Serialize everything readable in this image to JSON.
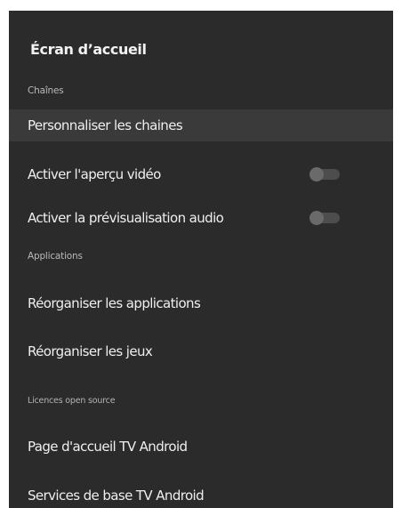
{
  "header": {
    "title": "Écran d’accueil"
  },
  "sections": {
    "channels": "Chaînes",
    "applications": "Applications",
    "licenses": "Licences open source"
  },
  "items": {
    "customize_channels": "Personnaliser les chaines",
    "video_preview": "Activer l'aperçu vidéo",
    "audio_preview": "Activer la prévisualisation audio",
    "reorder_apps": "Réorganiser les applications",
    "reorder_games": "Réorganiser les jeux",
    "home_android_tv": "Page d'accueil TV Android",
    "core_services_tv": "Services de base TV Android"
  },
  "toggles": {
    "video_preview_on": false,
    "audio_preview_on": false
  }
}
